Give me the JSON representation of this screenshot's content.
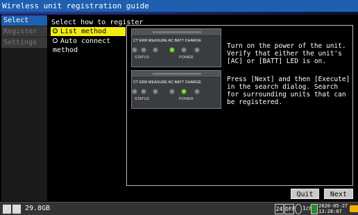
{
  "window": {
    "title": "Wireless unit registration guide"
  },
  "sidebar": {
    "items": [
      {
        "label": "Select",
        "active": true
      },
      {
        "label": "Register",
        "active": false
      },
      {
        "label": "Settings",
        "active": false
      }
    ]
  },
  "main": {
    "prompt": "Select how to register",
    "options": [
      {
        "label": "List method",
        "selected": true
      },
      {
        "label": "Auto connect method",
        "selected": false
      }
    ]
  },
  "steps": [
    {
      "text": "Turn on the power of the unit. Verify that either the unit's [AC] or [BATT] LED is on.",
      "device": {
        "led_labels": "CT ERR MEASURE  AC  BATT CHARGE",
        "status_group": "STATUS",
        "power_group": "POWER",
        "on_led": "AC"
      }
    },
    {
      "text": "Press [Next] and then [Execute] in the search dialog. Search for surrounding units that can be registered.",
      "device": {
        "led_labels": "CT ERR MEASURE  AC  BATT CHARGE",
        "status_group": "STATUS",
        "power_group": "POWER",
        "on_led": "BATT"
      }
    }
  ],
  "buttons": {
    "quit": "Quit",
    "next": "Next"
  },
  "statusbar": {
    "storage": "29.8GB",
    "box_24": "24",
    "box_off": "OFF",
    "channel": "1ch",
    "date": "2020-05-27",
    "time": "13:28:07"
  },
  "colors": {
    "title_bar": "#1f5fb0",
    "selected": "#f2ec13",
    "led_on": "#7fd83a"
  }
}
